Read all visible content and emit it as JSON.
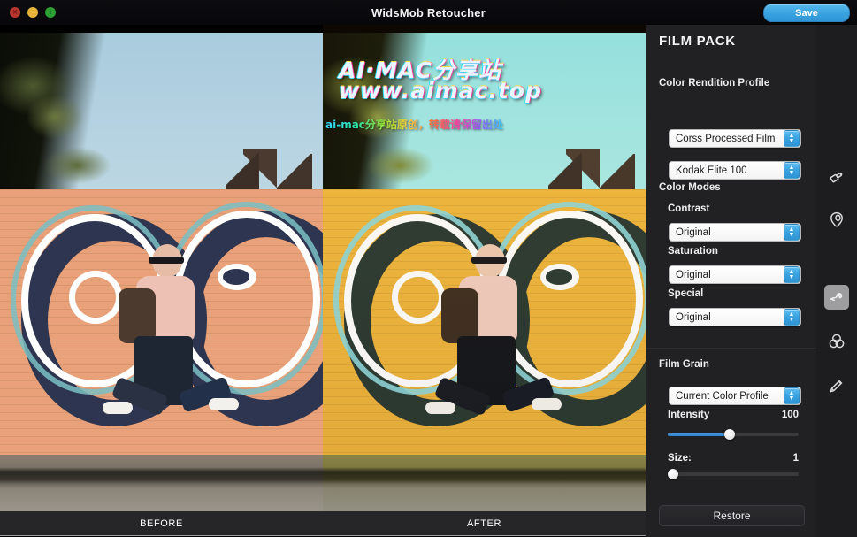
{
  "window": {
    "title": "WidsMob Retoucher",
    "save_label": "Save",
    "traffic": {
      "close": "×",
      "minimize": "−",
      "maximize": "+"
    }
  },
  "preview": {
    "before_label": "BEFORE",
    "after_label": "AFTER",
    "watermark": {
      "line1": "AI·MAC分享站",
      "line2": "www.aimac.top",
      "line3": "ai-mac分享站原创，转载请保留出处"
    }
  },
  "panel": {
    "title": "FILM PACK",
    "color_rendition": {
      "heading": "Color Rendition Profile",
      "profile_value": "Corss Processed Film",
      "film_value": "Kodak Elite 100"
    },
    "color_modes": {
      "heading": "Color Modes",
      "contrast_label": "Contrast",
      "contrast_value": "Original",
      "saturation_label": "Saturation",
      "saturation_value": "Original",
      "special_label": "Special",
      "special_value": "Original"
    },
    "film_grain": {
      "heading": "Film Grain",
      "profile_value": "Current Color Profile",
      "intensity_label": "Intensity",
      "intensity_value": "100",
      "intensity_percent": 47,
      "size_label": "Size:",
      "size_value": "1",
      "size_percent": 0
    },
    "restore_label": "Restore"
  },
  "toolbar": {
    "items": [
      {
        "name": "paintbrush-icon",
        "active": false
      },
      {
        "name": "vignette-icon",
        "active": false
      },
      {
        "name": "film-pack-icon",
        "active": true
      },
      {
        "name": "color-wheels-icon",
        "active": false
      },
      {
        "name": "pencil-icon",
        "active": false
      }
    ]
  },
  "colors": {
    "accent": "#3ba3e2",
    "panel_bg": "#212123",
    "titlebar_bg": "#0a0a0d",
    "rail_bg": "#1d1d1f"
  }
}
